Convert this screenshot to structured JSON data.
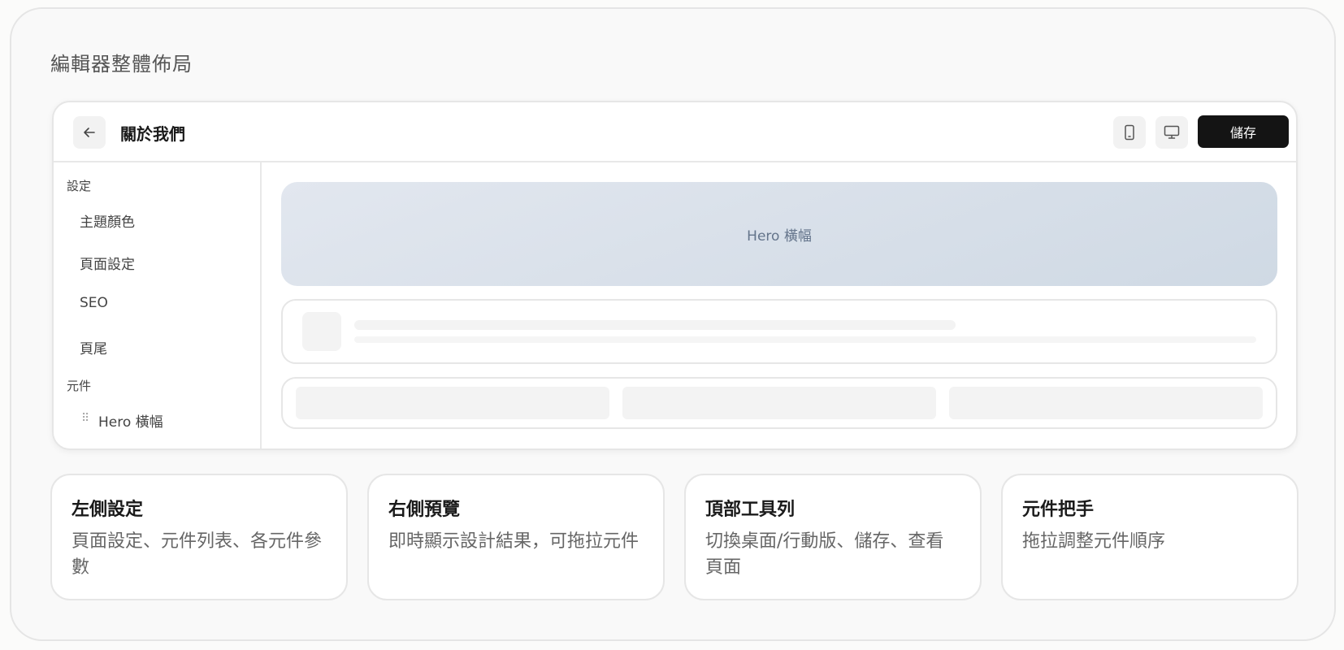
{
  "section_title": "編輯器整體佈局",
  "editor": {
    "page_name": "關於我們",
    "save_label": "儲存",
    "back_icon": "arrow-left-icon",
    "mobile_icon": "mobile-phone-icon",
    "desktop_icon": "desktop-monitor-icon"
  },
  "sidebar": {
    "settings_group": "設定",
    "settings_items": [
      {
        "label": "主題顏色"
      },
      {
        "label": "頁面設定"
      },
      {
        "label": "SEO"
      },
      {
        "label": "頁尾"
      }
    ],
    "components_group": "元件",
    "component_items": [
      {
        "label": "Hero 橫幅",
        "handle": "⠿"
      }
    ]
  },
  "preview": {
    "hero_label": "Hero 橫幅"
  },
  "cards": [
    {
      "title": "左側設定",
      "desc": "頁面設定、元件列表、各元件參數"
    },
    {
      "title": "右側預覽",
      "desc": "即時顯示設計結果，可拖拉元件"
    },
    {
      "title": "頂部工具列",
      "desc": "切換桌面/行動版、儲存、查看頁面"
    },
    {
      "title": "元件把手",
      "desc": "拖拉調整元件順序"
    }
  ],
  "colors": {
    "save_bg": "#141414",
    "hero_gradient_start": "#e2e7ef",
    "hero_gradient_end": "#cfd9e4"
  }
}
